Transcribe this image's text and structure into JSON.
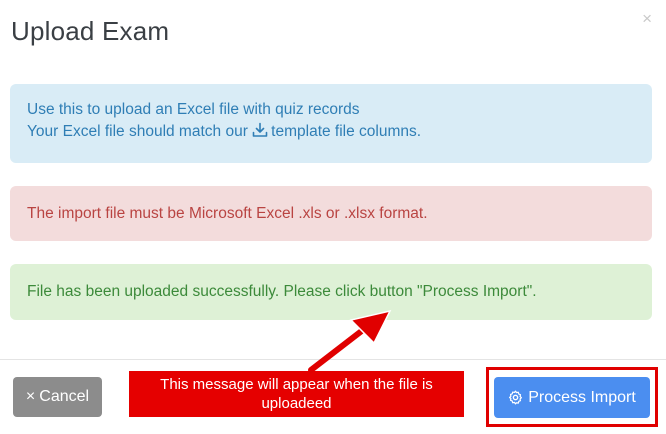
{
  "modal": {
    "title": "Upload Exam",
    "close_symbol": "×"
  },
  "alerts": {
    "info_line1": "Use this to upload an Excel file with quiz records",
    "info_line2_prefix": "Your Excel file should match our ",
    "info_link": "template file columns.",
    "info_link_icon": "download-icon",
    "danger": "The import file must be Microsoft Excel .xls or .xlsx format.",
    "success": "File has been uploaded successfully. Please click button \"Process Import\"."
  },
  "footer": {
    "cancel_symbol": "×",
    "cancel_label": "Cancel",
    "process_label": "Process Import",
    "process_icon": "gear-icon"
  },
  "annotation": {
    "callout_text": "This message will appear when the file is uploadeed",
    "color": "#e50000"
  },
  "colors": {
    "info_bg": "#d9ecf6",
    "danger_bg": "#f3dcdc",
    "success_bg": "#def1d6",
    "primary": "#4b8ef0",
    "secondary": "#8c8c8c"
  }
}
